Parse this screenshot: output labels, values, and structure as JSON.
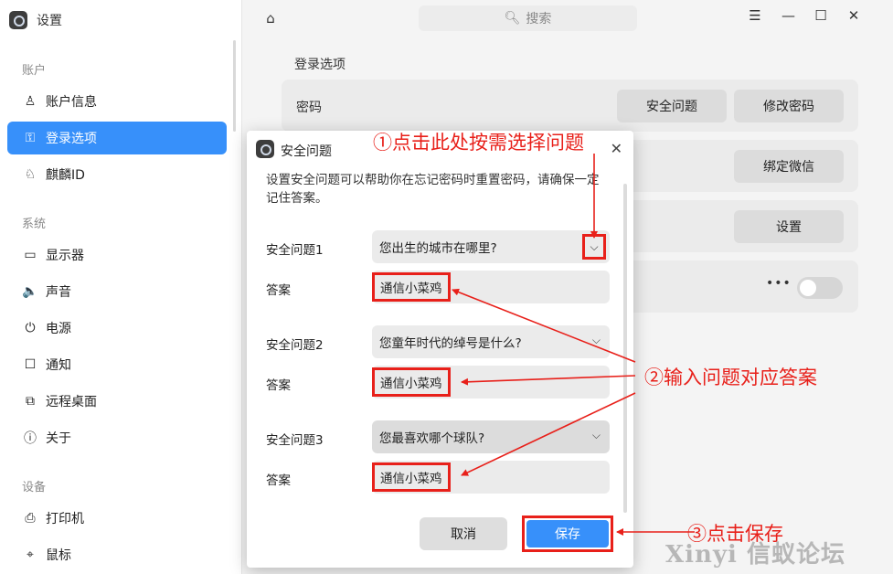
{
  "app": {
    "title": "设置",
    "icon": "settings-app-icon"
  },
  "sidebar": {
    "sections": [
      {
        "label": "账户"
      },
      {
        "label": "系统"
      },
      {
        "label": "设备"
      }
    ],
    "items": [
      {
        "label": "账户信息",
        "icon": "user-icon",
        "glyph": "♙"
      },
      {
        "label": "登录选项",
        "icon": "key-icon",
        "glyph": "⚿",
        "active": true
      },
      {
        "label": "麒麟ID",
        "icon": "kylin-id-icon",
        "glyph": "♘"
      },
      {
        "label": "显示器",
        "icon": "monitor-icon",
        "glyph": "▭"
      },
      {
        "label": "声音",
        "icon": "speaker-icon",
        "glyph": "🔈"
      },
      {
        "label": "电源",
        "icon": "power-icon",
        "glyph": "⏻"
      },
      {
        "label": "通知",
        "icon": "notification-icon",
        "glyph": "☐"
      },
      {
        "label": "远程桌面",
        "icon": "remote-desktop-icon",
        "glyph": "⧉"
      },
      {
        "label": "关于",
        "icon": "info-icon",
        "glyph": "ⓘ"
      },
      {
        "label": "打印机",
        "icon": "printer-icon",
        "glyph": "⎙"
      },
      {
        "label": "鼠标",
        "icon": "mouse-icon",
        "glyph": "⌖"
      }
    ]
  },
  "titlebar": {
    "home_icon": "home-icon",
    "search_placeholder": "搜索",
    "window_buttons": [
      "menu-icon",
      "minimize-icon",
      "maximize-icon",
      "close-icon"
    ]
  },
  "main": {
    "title": "登录选项",
    "rows": [
      {
        "label": "密码",
        "buttons": [
          "安全问题",
          "修改密码"
        ]
      },
      {
        "label": "",
        "buttons": [
          "绑定微信"
        ]
      },
      {
        "label": "",
        "buttons": [
          "设置"
        ]
      },
      {
        "label": "",
        "dots": "•••",
        "toggle": false
      }
    ]
  },
  "dialog": {
    "title": "安全问题",
    "description": "设置安全问题可以帮助你在忘记密码时重置密码，请确保一定记住答案。",
    "questions": [
      {
        "label": "安全问题1",
        "question": "您出生的城市在哪里?",
        "answer_label": "答案",
        "answer": "通信小菜鸡"
      },
      {
        "label": "安全问题2",
        "question": "您童年时代的绰号是什么?",
        "answer_label": "答案",
        "answer": "通信小菜鸡"
      },
      {
        "label": "安全问题3",
        "question": "您最喜欢哪个球队?",
        "answer_label": "答案",
        "answer": "通信小菜鸡"
      }
    ],
    "cancel_label": "取消",
    "save_label": "保存"
  },
  "annotations": {
    "step1": "①点击此处按需选择问题",
    "step2": "②输入问题对应答案",
    "step3": "③点击保存",
    "color": "#e8201a"
  },
  "watermark": "Xinyi 信蚁论坛",
  "colors": {
    "accent": "#3790fa",
    "annotation": "#e8201a"
  }
}
